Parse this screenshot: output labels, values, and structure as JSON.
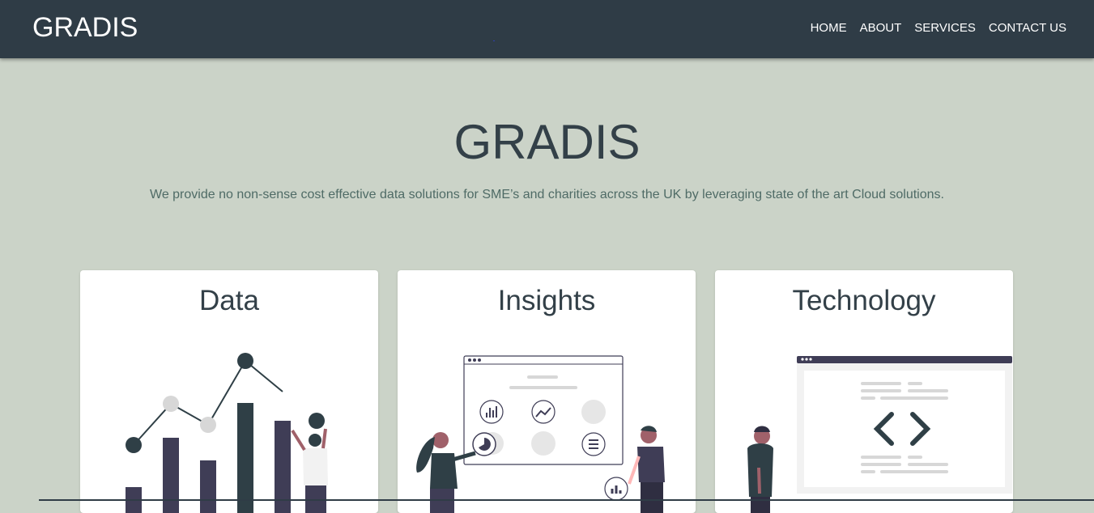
{
  "navbar": {
    "brand": "GRADIS",
    "links": [
      {
        "label": "HOME"
      },
      {
        "label": "ABOUT"
      },
      {
        "label": "SERVICES"
      },
      {
        "label": "CONTACT US"
      }
    ]
  },
  "hero": {
    "title": "GRADIS",
    "subtitle": "We provide no non-sense cost effective data solutions for SME’s and charities across the UK by leveraging state of the art Cloud solutions."
  },
  "cards": [
    {
      "title": "Data",
      "icon": "data-chart-illustration"
    },
    {
      "title": "Insights",
      "icon": "dashboard-illustration"
    },
    {
      "title": "Technology",
      "icon": "code-window-illustration"
    }
  ],
  "colors": {
    "navbar": "#2f3c46",
    "background": "#cbd3c8",
    "heading": "#334048",
    "subtitle": "#4f6b66",
    "accent_dark": "#2f3f46",
    "accent_purple": "#3f3d56"
  }
}
